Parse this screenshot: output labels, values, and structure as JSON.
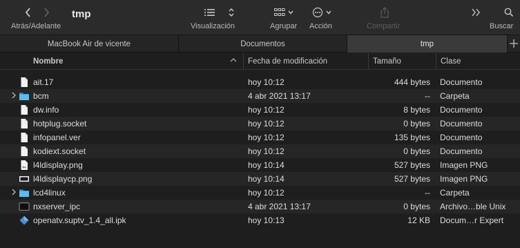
{
  "window": {
    "title": "tmp"
  },
  "toolbar": {
    "nav_label": "Atrás/Adelante",
    "view_label": "Visualización",
    "group_label": "Agrupar",
    "action_label": "Acción",
    "share_label": "Compartir",
    "search_label": "Buscar"
  },
  "tabs": [
    {
      "label": "MacBook Air de vicente",
      "active": false
    },
    {
      "label": "Documentos",
      "active": false
    },
    {
      "label": "tmp",
      "active": true
    }
  ],
  "columns": {
    "name": "Nombre",
    "date": "Fecha de modificación",
    "size": "Tamaño",
    "kind": "Clase"
  },
  "files": [
    {
      "name": "ait.17",
      "date": "hoy 10:12",
      "size": "444 bytes",
      "kind": "Documento",
      "icon": "document"
    },
    {
      "name": "bcm",
      "date": "4 abr 2021 13:17",
      "size": "--",
      "kind": "Carpeta",
      "icon": "folder"
    },
    {
      "name": "dw.info",
      "date": "hoy 10:12",
      "size": "8 bytes",
      "kind": "Documento",
      "icon": "document"
    },
    {
      "name": "hotplug.socket",
      "date": "hoy 10:12",
      "size": "0 bytes",
      "kind": "Documento",
      "icon": "document"
    },
    {
      "name": "infopanel.ver",
      "date": "hoy 10:12",
      "size": "135 bytes",
      "kind": "Documento",
      "icon": "document"
    },
    {
      "name": "kodiext.socket",
      "date": "hoy 10:12",
      "size": "0 bytes",
      "kind": "Documento",
      "icon": "document"
    },
    {
      "name": "l4ldisplay.png",
      "date": "hoy 10:14",
      "size": "527 bytes",
      "kind": "Imagen PNG",
      "icon": "image"
    },
    {
      "name": "l4ldisplaycp.png",
      "date": "hoy 10:14",
      "size": "527 bytes",
      "kind": "Imagen PNG",
      "icon": "image-wide"
    },
    {
      "name": "lcd4linux",
      "date": "hoy 10:12",
      "size": "--",
      "kind": "Carpeta",
      "icon": "folder"
    },
    {
      "name": "nxserver_ipc",
      "date": "4 abr 2021 13:17",
      "size": "0 bytes",
      "kind": "Archivo…ble Unix",
      "icon": "terminal"
    },
    {
      "name": "openatv.suptv_1.4_all.ipk",
      "date": "hoy 10:13",
      "size": "12 KB",
      "kind": "Docum…r Expert",
      "icon": "package"
    }
  ]
}
